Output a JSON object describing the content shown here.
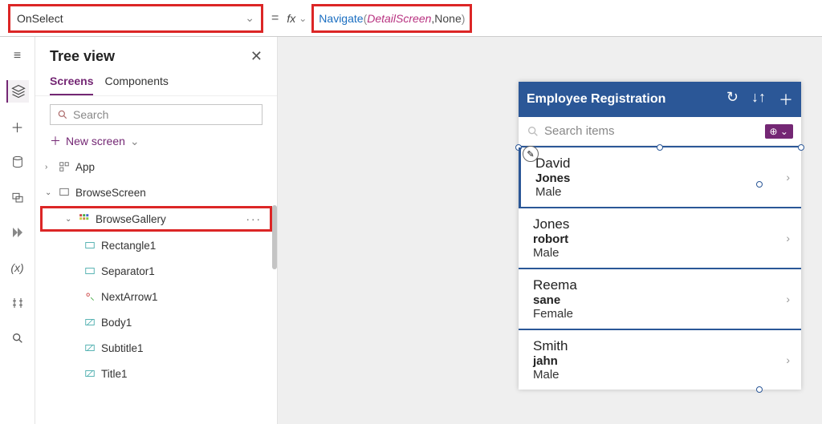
{
  "property_dropdown": {
    "value": "OnSelect"
  },
  "formula": {
    "func": "Navigate",
    "arg": "DetailScreen",
    "enum": "None"
  },
  "panel": {
    "title": "Tree view",
    "tabs": {
      "screens": "Screens",
      "components": "Components"
    },
    "search_placeholder": "Search",
    "new_screen": "New screen"
  },
  "tree": {
    "app": "App",
    "browse_screen": "BrowseScreen",
    "browse_gallery": "BrowseGallery",
    "children": [
      "Rectangle1",
      "Separator1",
      "NextArrow1",
      "Body1",
      "Subtitle1",
      "Title1"
    ]
  },
  "phone": {
    "title": "Employee Registration",
    "search_placeholder": "Search items"
  },
  "gallery_items": [
    {
      "name": "David",
      "sub": "Jones",
      "meta": "Male"
    },
    {
      "name": "Jones",
      "sub": "robort",
      "meta": "Male"
    },
    {
      "name": "Reema",
      "sub": "sane",
      "meta": "Female"
    },
    {
      "name": "Smith",
      "sub": "jahn",
      "meta": "Male"
    }
  ]
}
